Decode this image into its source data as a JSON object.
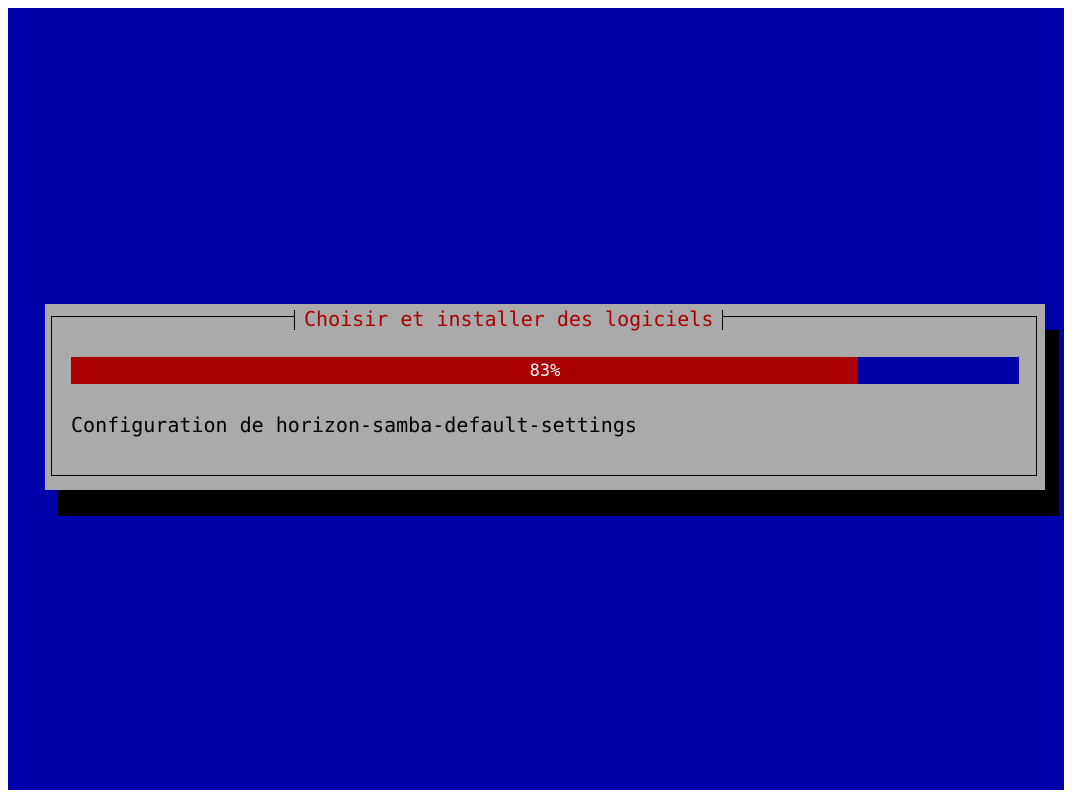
{
  "dialog": {
    "title": "Choisir et installer des logiciels",
    "status_text": "Configuration de horizon-samba-default-settings"
  },
  "progress": {
    "percent": 83,
    "label": "83%"
  },
  "colors": {
    "background": "#0000aa",
    "dialog": "#aaaaaa",
    "title_text": "#aa0000",
    "progress_fill": "#aa0000",
    "progress_track": "#0000aa",
    "progress_text": "#ffffff",
    "shadow": "#000000"
  }
}
